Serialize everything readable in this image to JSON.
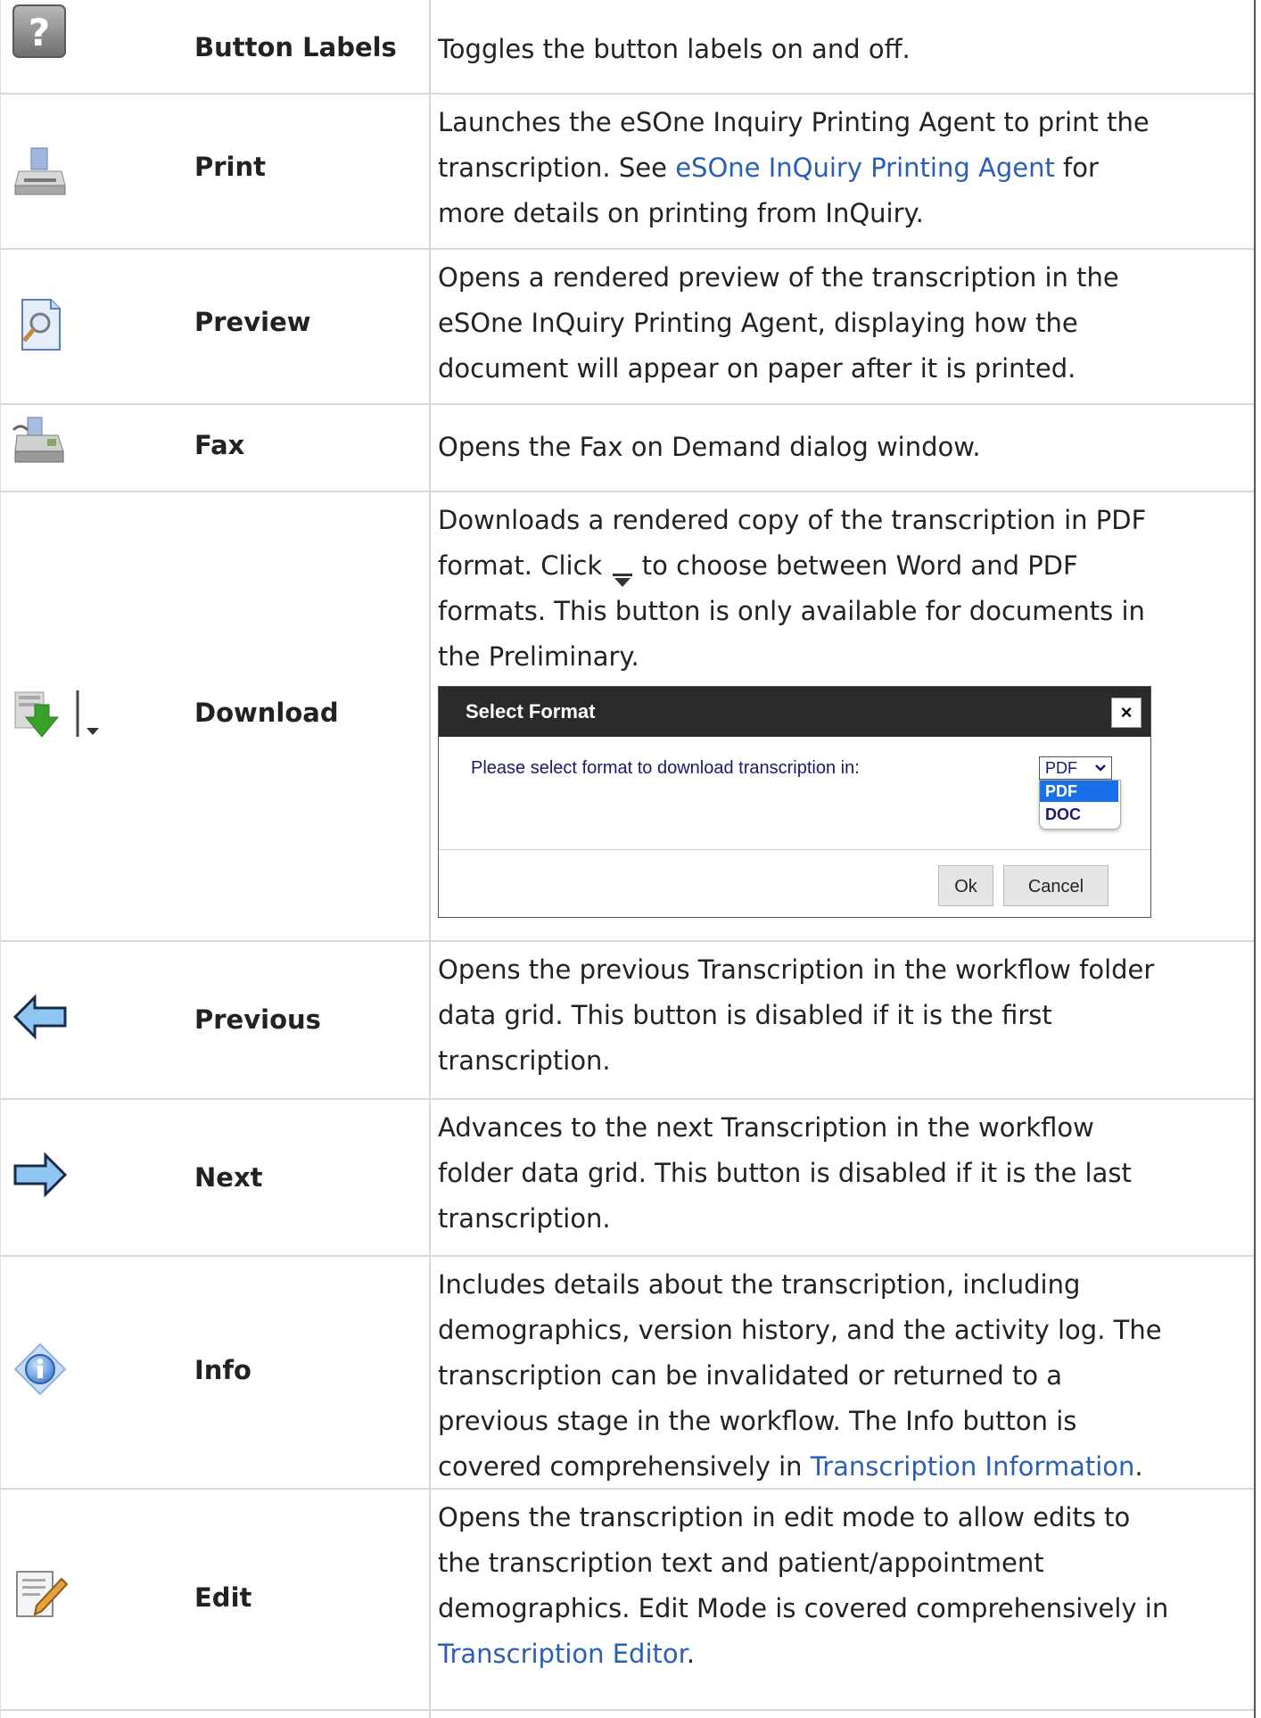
{
  "rows": [
    {
      "icon": "question-mark-icon",
      "label": "Button Labels",
      "lines": [
        "Toggles the button labels on and off."
      ]
    },
    {
      "icon": "printer-icon",
      "label": "Print",
      "lines": [
        "Launches the eSOne Inquiry Printing Agent to print the"
      ],
      "line2_pre": "transcription. See ",
      "line2_link": "eSOne InQuiry Printing Agent",
      "line2_post": " for",
      "line3": "more details on printing from InQuiry."
    },
    {
      "icon": "preview-magnifier-icon",
      "label": "Preview",
      "lines": [
        "Opens a rendered preview of the transcription in the",
        "eSOne InQuiry Printing Agent, displaying how the",
        "document will appear on paper after it is printed."
      ]
    },
    {
      "icon": "fax-machine-icon",
      "label": "Fax",
      "lines": [
        "Opens the Fax on Demand dialog window."
      ]
    },
    {
      "icon": "download-arrow-icon",
      "label": "Download",
      "line1": "Downloads a rendered copy of the transcription in PDF",
      "line2_pre": "format. Click ",
      "line2_post": " to choose between Word and PDF",
      "line3": "formats. This button is only available for documents in",
      "line4": "the Preliminary."
    },
    {
      "icon": "left-arrow-icon",
      "label": "Previous",
      "lines": [
        "Opens the previous Transcription in the workflow folder",
        "data grid. This button is disabled if it is the first",
        "transcription."
      ]
    },
    {
      "icon": "right-arrow-icon",
      "label": "Next",
      "lines": [
        "Advances to the next Transcription in the workflow",
        "folder data grid. This button is disabled if it is the last",
        "transcription."
      ]
    },
    {
      "icon": "info-icon",
      "label": "Info",
      "lines": [
        "Includes details about the transcription, including",
        "demographics, version history, and the activity log. The",
        "transcription can be invalidated or returned to a",
        "previous stage in the workflow. The Info button is"
      ],
      "line5_pre": "covered comprehensively in ",
      "line5_link": "Transcription Information",
      "line5_post": "."
    },
    {
      "icon": "edit-pencil-icon",
      "label": "Edit",
      "lines": [
        "Opens the transcription in edit mode to allow edits to",
        "the transcription text and patient/appointment",
        "demographics. Edit Mode is covered comprehensively in"
      ],
      "line4_link": "Transcription Editor",
      "line4_post": "."
    }
  ],
  "dialog": {
    "title": "Select Format",
    "close": "×",
    "prompt": "Please select format to download transcription in:",
    "selected": "PDF",
    "options": [
      "PDF",
      "DOC"
    ],
    "ok": "Ok",
    "cancel": "Cancel"
  },
  "colors": {
    "link": "#2b5fb4",
    "border": "#d9d9d9",
    "dialog_header": "#2a2a2a",
    "option_highlight": "#1a6fe8"
  }
}
